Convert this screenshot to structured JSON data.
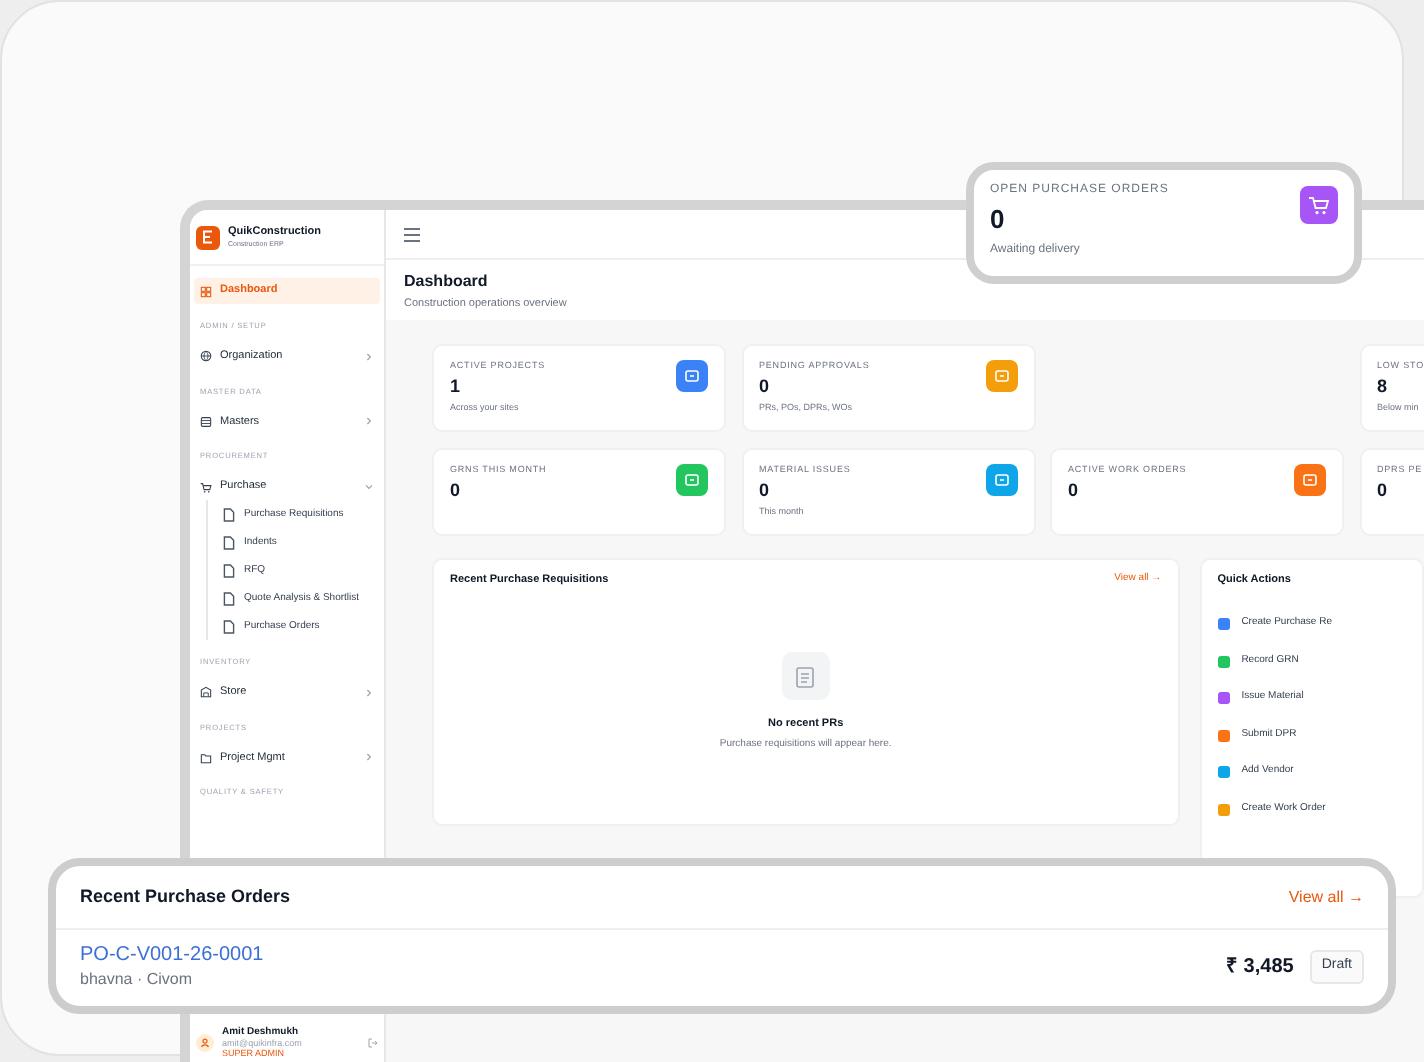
{
  "sidebar": {
    "brand": {
      "name": "QuikConstruction",
      "subtitle": "Construction ERP"
    },
    "items": [
      {
        "kind": "link",
        "label": "Dashboard",
        "selected": true
      },
      {
        "kind": "heading",
        "label": "ADMIN / SETUP"
      },
      {
        "kind": "link",
        "label": "Organization",
        "selected": false,
        "expanded": false
      },
      {
        "kind": "heading",
        "label": "MASTER DATA"
      },
      {
        "kind": "link",
        "label": "Masters",
        "selected": false,
        "expanded": false
      },
      {
        "kind": "heading",
        "label": "PROCUREMENT"
      },
      {
        "kind": "link",
        "label": "Purchase",
        "selected": false,
        "expanded": true,
        "children": [
          {
            "label": "Purchase Requisitions",
            "selected": false
          },
          {
            "label": "Indents",
            "selected": false
          },
          {
            "label": "RFQ",
            "selected": false
          },
          {
            "label": "Quote Analysis & Shortlist",
            "selected": false
          },
          {
            "label": "Purchase Orders",
            "selected": false
          }
        ]
      },
      {
        "kind": "heading",
        "label": "INVENTORY"
      },
      {
        "kind": "link",
        "label": "Store",
        "selected": false,
        "expanded": false
      },
      {
        "kind": "heading",
        "label": "PROJECTS"
      },
      {
        "kind": "link",
        "label": "Project Mgmt",
        "selected": false,
        "expanded": false
      },
      {
        "kind": "heading",
        "label": "QUALITY & SAFETY"
      }
    ],
    "user": {
      "name": "Amit Deshmukh",
      "email": "amit@quikinfra.com",
      "role": "SUPER ADMIN"
    }
  },
  "page": {
    "title": "Dashboard",
    "subtitle": "Construction operations overview"
  },
  "stat_rows": [
    [
      {
        "label": "ACTIVE PROJECTS",
        "value": "1",
        "note": "Across your sites",
        "color": "#3b82f6"
      },
      {
        "label": "PENDING APPROVALS",
        "value": "0",
        "note": "PRs, POs, DPRs, WOs",
        "color": "#f59e0b"
      },
      {
        "label": "LOW STO",
        "value": "8",
        "note": "Below min"
      }
    ],
    [
      {
        "label": "GRNS THIS MONTH",
        "value": "0",
        "color": "#22c55e"
      },
      {
        "label": "MATERIAL ISSUES",
        "value": "0",
        "note": "This month",
        "color": "#0ea5e9"
      },
      {
        "label": "ACTIVE WORK ORDERS",
        "value": "0",
        "color": "#f97316"
      },
      {
        "label": "DPRS PE",
        "value": "0"
      }
    ]
  ],
  "recent_requisitions": {
    "title": "Recent Purchase Requisitions",
    "link": "View all →",
    "empty_title": "No recent PRs",
    "empty_text": "Purchase requisitions will appear here."
  },
  "quick_actions": {
    "title": "Quick Actions",
    "items": [
      {
        "label": "Create Purchase Re",
        "color": "#3b82f6"
      },
      {
        "label": "Record GRN",
        "color": "#22c55e"
      },
      {
        "label": "Issue Material",
        "color": "#a855f7"
      },
      {
        "label": "Submit DPR",
        "color": "#f97316"
      },
      {
        "label": "Add Vendor",
        "color": "#0ea5e9"
      },
      {
        "label": "Create Work Order",
        "color": "#f59e0b"
      }
    ]
  },
  "open_po_card": {
    "label": "OPEN PURCHASE ORDERS",
    "value": "0",
    "note": "Awaiting delivery",
    "color": "#a855f7"
  },
  "recent_orders": {
    "title": "Recent Purchase Orders",
    "link": "View all →",
    "rows": [
      {
        "number": "PO-C-V001-26-0001",
        "meta": "bhavna · Civom",
        "amount": "₹ 3,485",
        "status": "Draft"
      }
    ]
  }
}
